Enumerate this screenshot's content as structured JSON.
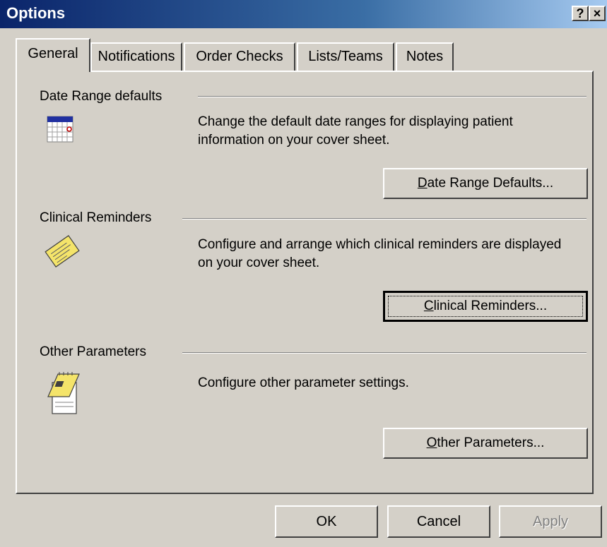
{
  "window": {
    "title": "Options",
    "help_glyph": "?",
    "close_glyph": "×"
  },
  "tabs": [
    {
      "label": "General",
      "active": true
    },
    {
      "label": "Notifications",
      "active": false
    },
    {
      "label": "Order Checks",
      "active": false
    },
    {
      "label": "Lists/Teams",
      "active": false
    },
    {
      "label": "Notes",
      "active": false
    }
  ],
  "sections": {
    "date_range": {
      "label": "Date Range defaults",
      "description": "Change the default date ranges for displaying patient information on your cover sheet.",
      "button_access": "D",
      "button_rest": "ate Range Defaults...",
      "icon": "calendar-icon"
    },
    "clinical_reminders": {
      "label": "Clinical Reminders",
      "description": "Configure and arrange which clinical reminders are displayed on your cover sheet.",
      "button_access": "C",
      "button_rest": "linical Reminders...",
      "icon": "reminder-note-icon"
    },
    "other_parameters": {
      "label": "Other Parameters",
      "description": "Configure other parameter settings.",
      "button_access": "O",
      "button_rest": "ther Parameters...",
      "icon": "notepad-icon"
    }
  },
  "footer": {
    "ok": "OK",
    "cancel": "Cancel",
    "apply": "Apply"
  },
  "colors": {
    "face": "#d4d0c8",
    "title_bar": "#0a246a",
    "icon_yellow": "#f4e46a"
  }
}
